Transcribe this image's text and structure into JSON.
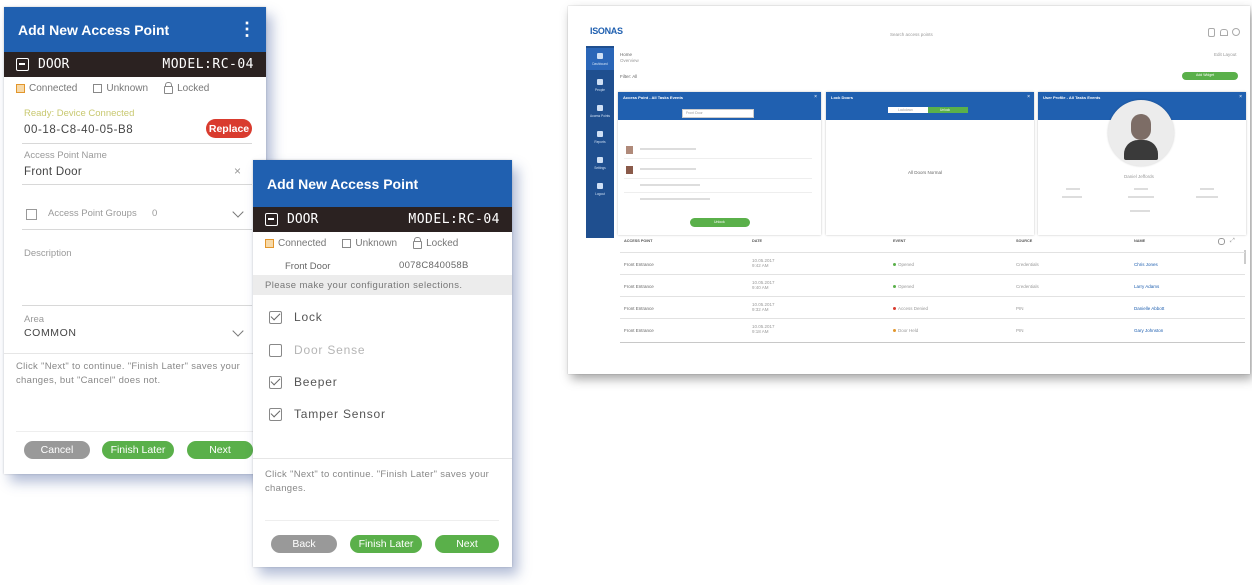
{
  "dialog1": {
    "title": "Add New Access Point",
    "menu_icon": "⋮",
    "device_type": "DOOR",
    "model": "MODEL:RC-04",
    "status": {
      "connected": "Connected",
      "unknown": "Unknown",
      "locked": "Locked"
    },
    "ready_label": "Ready: Device Connected",
    "mac_value": "00-18-C8-40-05-B8",
    "replace_label": "Replace",
    "name_label": "Access Point Name",
    "name_value": "Front Door",
    "groups_placeholder": "Access Point Groups",
    "groups_count": "0",
    "description_placeholder": "Description",
    "area_label": "Area",
    "area_value": "COMMON",
    "hint": "Click \"Next\" to continue. \"Finish Later\" saves your changes, but \"Cancel\" does not.",
    "buttons": {
      "cancel": "Cancel",
      "finish_later": "Finish Later",
      "next": "Next"
    }
  },
  "dialog2": {
    "title": "Add New Access Point",
    "device_type": "DOOR",
    "model": "MODEL:RC-04",
    "status": {
      "connected": "Connected",
      "unknown": "Unknown",
      "locked": "Locked"
    },
    "door_name": "Front Door",
    "mac_value": "0078C840058B",
    "config_prompt": "Please make your configuration selections.",
    "options": [
      {
        "label": "Lock",
        "checked": true,
        "enabled": true
      },
      {
        "label": "Door Sense",
        "checked": false,
        "enabled": false
      },
      {
        "label": "Beeper",
        "checked": true,
        "enabled": true
      },
      {
        "label": "Tamper Sensor",
        "checked": true,
        "enabled": true
      }
    ],
    "hint": "Click \"Next\" to continue. \"Finish Later\" saves your changes.",
    "buttons": {
      "back": "Back",
      "finish_later": "Finish Later",
      "next": "Next"
    }
  },
  "dashboard": {
    "logo": "ISONAS",
    "search_placeholder": "Search access points",
    "top_icons": [
      "user-icon",
      "bell-icon",
      "account-icon"
    ],
    "page_title": "Home",
    "page_sub": "Overview",
    "filter_label": "Filter: All",
    "top_right_link": "Edit Layout",
    "add_button": "Add Widget",
    "sidebar": [
      "Dashboard",
      "People",
      "Access Points",
      "Reports",
      "Settings",
      "Logout"
    ],
    "cards": [
      {
        "title": "Access Point - All Tasks Events",
        "select": "Front Door",
        "button": "Unlock"
      },
      {
        "title": "Lock Doors",
        "tabs": [
          "Lockdown",
          "Unlock"
        ],
        "empty": "All Doors Normal"
      },
      {
        "title": "User Profile - All Tasks Events",
        "name": "Daniel Jeffords"
      }
    ],
    "table": {
      "headers": [
        "ACCESS POINT",
        "DATE",
        "EVENT",
        "SOURCE",
        "NAME"
      ],
      "rows": [
        [
          "Front Entrance",
          "10.05.2017 9:42 AM",
          "Opened",
          "Credentials",
          "Chris Jones"
        ],
        [
          "Front Entrance",
          "10.05.2017 9:40 AM",
          "Opened",
          "Credentials",
          "Larry Adams"
        ],
        [
          "Front Entrance",
          "10.05.2017 9:32 AM",
          "Access Denied",
          "PIN",
          "Danielle Abbott"
        ],
        [
          "Front Entrance",
          "10.05.2017 9:18 AM",
          "Door Held",
          "PIN",
          "Gary Johnston"
        ]
      ]
    }
  }
}
